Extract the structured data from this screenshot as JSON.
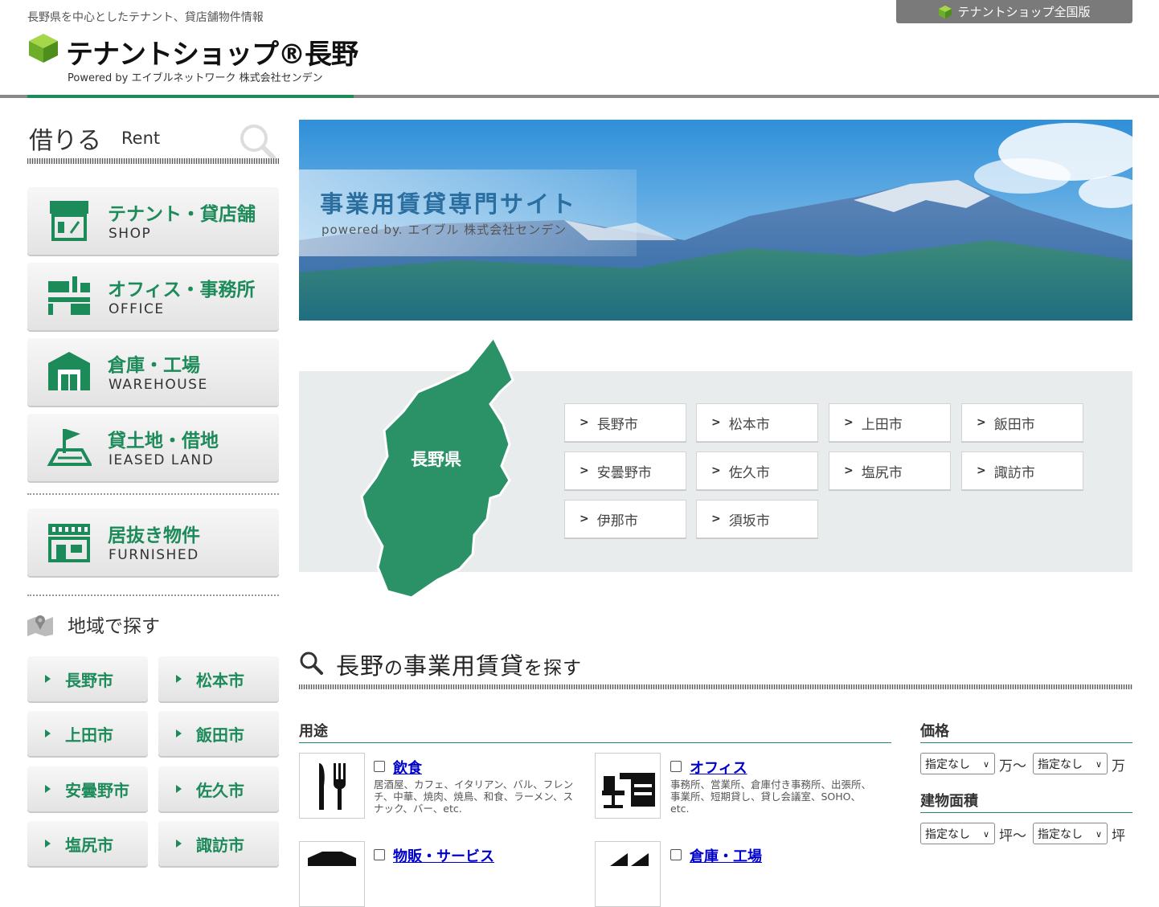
{
  "header": {
    "tagline": "長野県を中心としたテナント、貸店舗物件情報",
    "logo": "テナントショップ®長野",
    "powered": "Powered by  エイブルネットワーク  株式会社センデン",
    "national_link": "テナントショップ全国版"
  },
  "sidebar": {
    "rent_jp": "借りる",
    "rent_en": "Rent",
    "categories": [
      {
        "jp": "テナント・貸店舗",
        "en": "SHOP",
        "icon": "shop-icon"
      },
      {
        "jp": "オフィス・事務所",
        "en": "OFFICE",
        "icon": "office-icon"
      },
      {
        "jp": "倉庫・工場",
        "en": "WAREHOUSE",
        "icon": "warehouse-icon"
      },
      {
        "jp": "貸土地・借地",
        "en": "IEASED LAND",
        "icon": "land-icon"
      },
      {
        "jp": "居抜き物件",
        "en": "FURNISHED",
        "icon": "furnished-icon"
      }
    ],
    "area_title": "地域で探す",
    "areas": [
      "長野市",
      "松本市",
      "上田市",
      "飯田市",
      "安曇野市",
      "佐久市",
      "塩尻市",
      "諏訪市"
    ]
  },
  "hero": {
    "title": "事業用賃貸専門サイト",
    "sub": "powered by. エイブル  株式会社センデン"
  },
  "map": {
    "label": "長野県",
    "cities": [
      "長野市",
      "松本市",
      "上田市",
      "飯田市",
      "安曇野市",
      "佐久市",
      "塩尻市",
      "諏訪市",
      "伊那市",
      "須坂市"
    ]
  },
  "search": {
    "title_a": "長野",
    "title_b": "の",
    "title_c": "事業用賃貸",
    "title_d": "を探す",
    "use_label": "用途",
    "uses": [
      {
        "title": "飲食",
        "desc": "居酒屋、カフェ、イタリアン、バル、フレンチ、中華、焼肉、焼鳥、和食、ラーメン、スナック、バー、etc."
      },
      {
        "title": "オフィス",
        "desc": "事務所、営業所、倉庫付き事務所、出張所、事業所、短期貸し、貸し会議室、SOHO、etc."
      },
      {
        "title": "物販・サービス",
        "desc": ""
      },
      {
        "title": "倉庫・工場",
        "desc": ""
      }
    ],
    "price_label": "価格",
    "price_from": "指定なし",
    "price_to": "指定なし",
    "price_unit": "万",
    "area_label": "建物面積",
    "area_from": "指定なし",
    "area_to": "指定なし",
    "area_unit": "坪",
    "tilde": "〜"
  },
  "colors": {
    "accent": "#1d8a5a",
    "link": "#0000cc"
  }
}
